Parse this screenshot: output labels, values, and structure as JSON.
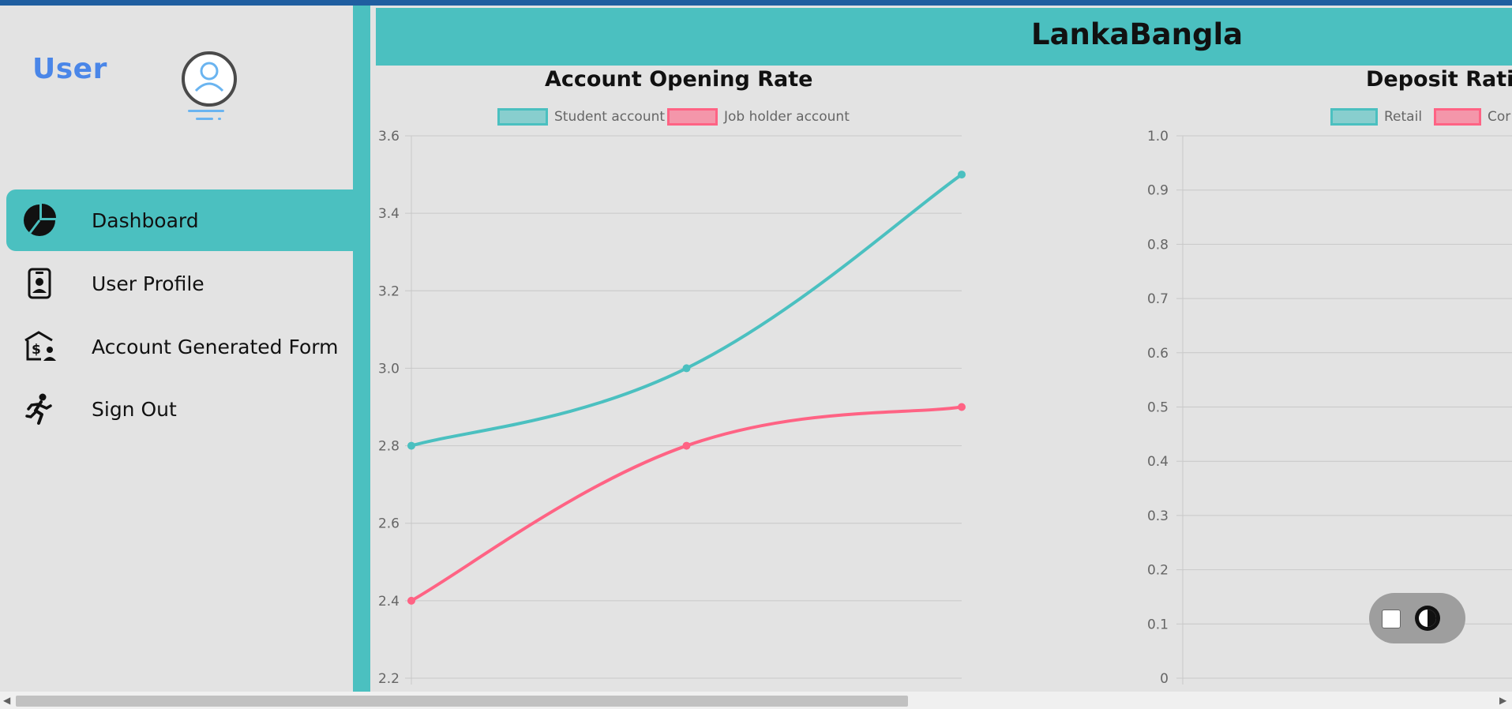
{
  "sidebar": {
    "user_title": "User",
    "nav": [
      {
        "label": "Dashboard",
        "icon": "pie-chart-icon",
        "active": true
      },
      {
        "label": "User Profile",
        "icon": "id-badge-icon",
        "active": false
      },
      {
        "label": "Account Generated Form",
        "icon": "bank-user-icon",
        "active": false
      },
      {
        "label": "Sign Out",
        "icon": "running-person-icon",
        "active": false
      }
    ]
  },
  "header": {
    "title": "LankaBangla"
  },
  "colors": {
    "teal": "#4bc0c0",
    "pink": "#ff6384",
    "accent_blue": "#4a86e8",
    "top_bar": "#1f5ea0"
  },
  "chart_data": [
    {
      "type": "line",
      "title": "Account Opening Rate",
      "x": [
        0,
        1,
        2
      ],
      "series": [
        {
          "name": "Student account",
          "color": "#4bc0c0",
          "values": [
            2.8,
            3.0,
            3.5
          ]
        },
        {
          "name": "Job holder account",
          "color": "#ff6384",
          "values": [
            2.4,
            2.8,
            2.9
          ]
        }
      ],
      "ylim": [
        2.2,
        3.6
      ],
      "yticks": [
        "3.6",
        "3.4",
        "3.2",
        "3.0",
        "2.8",
        "2.6",
        "2.4",
        "2.2"
      ],
      "legend": "top",
      "grid": true
    },
    {
      "type": "bar",
      "title": "Deposit Ratio",
      "title_visible": "Deposit Ratic",
      "series": [
        {
          "name": "Retail",
          "color": "#4bc0c0",
          "values": []
        },
        {
          "name": "Cor",
          "color": "#ff6384",
          "values": []
        }
      ],
      "ylim": [
        0,
        1.0
      ],
      "yticks": [
        "1.0",
        "0.9",
        "0.8",
        "0.7",
        "0.6",
        "0.5",
        "0.4",
        "0.3",
        "0.2",
        "0.1",
        "0"
      ],
      "legend": "top",
      "grid": true
    }
  ]
}
